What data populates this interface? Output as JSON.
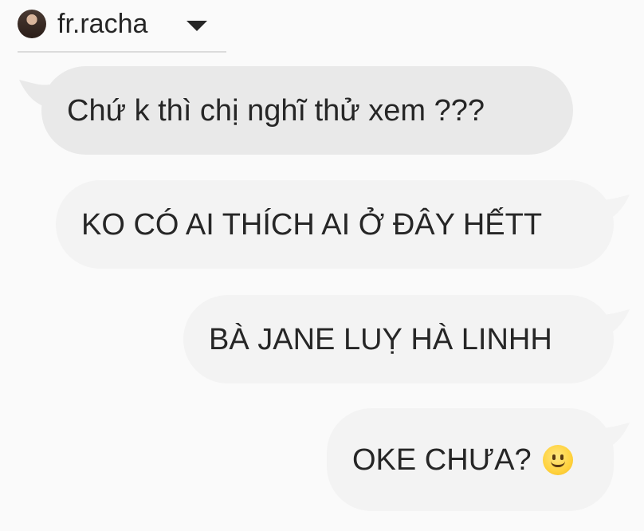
{
  "header": {
    "username": "fr.racha"
  },
  "messages": [
    {
      "direction": "incoming",
      "text": "Chứ k thì chị nghĩ thử xem ???"
    },
    {
      "direction": "outgoing",
      "text": "KO CÓ AI THÍCH AI Ở ĐÂY HẾTT"
    },
    {
      "direction": "outgoing",
      "text": "BÀ JANE LUỴ HÀ LINHH"
    },
    {
      "direction": "outgoing",
      "text": "OKE CHƯA?",
      "emoji": "slightly-smiling-face-icon"
    }
  ],
  "colors": {
    "background": "#fafafa",
    "incoming_bubble": "#e9e9e9",
    "outgoing_bubble": "#f3f3f3",
    "text": "#262626",
    "divider": "#dbdbdb"
  }
}
